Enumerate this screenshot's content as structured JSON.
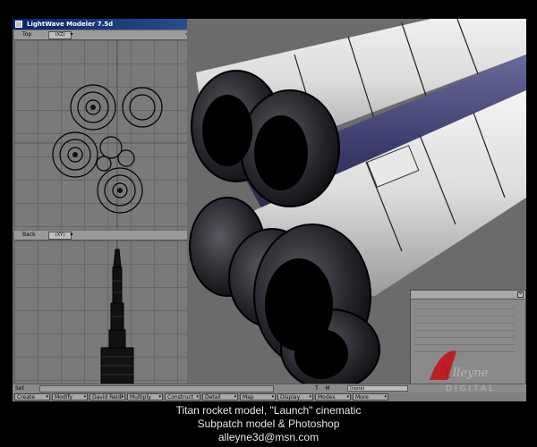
{
  "window": {
    "title": "LightWave Modeler 7.5d"
  },
  "viewports": {
    "top": {
      "label": "Top",
      "mode": "(XZ)"
    },
    "back": {
      "label": "Back",
      "mode": "(XY)"
    }
  },
  "statusbar": {
    "sets_label": "Set",
    "mode_buttons": [
      "T",
      "M"
    ],
    "surface_value": "(none)"
  },
  "menus": [
    "Create",
    "Modify",
    "David Reidl",
    "Multiply",
    "Construct",
    "Detail",
    "Map",
    "Display",
    "Modes",
    "More"
  ],
  "logo": {
    "name": "Alleyne",
    "subtitle": "DIGITAL"
  },
  "caption": {
    "line1": "Titan rocket model, \"Launch\" cinematic",
    "line2": "Subpatch model & Photoshop",
    "line3": "alleyne3d@msn.com"
  },
  "colors": {
    "titlebar": "#0a246a",
    "logo_red": "#c0141a"
  }
}
